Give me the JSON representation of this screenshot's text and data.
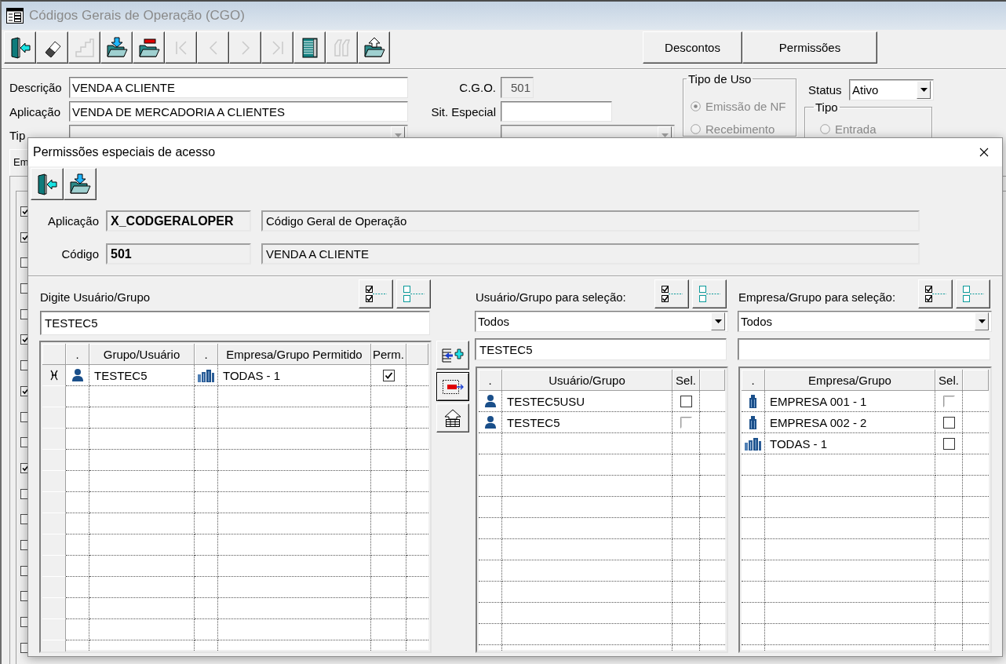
{
  "main_window": {
    "title": "Códigos Gerais de Operação (CGO)",
    "toolbar": [
      {
        "disabled": false
      },
      {
        "disabled": false
      },
      {
        "disabled": true
      },
      {
        "disabled": false
      },
      {
        "disabled": false
      },
      {
        "disabled": true
      },
      {
        "disabled": true
      },
      {
        "disabled": true
      },
      {
        "disabled": true
      },
      {
        "disabled": false
      },
      {
        "disabled": true
      },
      {
        "disabled": false
      }
    ],
    "buttons": [
      "Descontos",
      "Permissões"
    ],
    "fields_left": [
      {
        "kind": "text",
        "label": "Descrição",
        "value": "VENDA A CLIENTE",
        "disabled": false
      },
      {
        "kind": "text",
        "label": "Aplicação",
        "value": "VENDA DE MERCADORIA A CLIENTES",
        "disabled": false
      },
      {
        "kind": "dropdown",
        "label": "Tip",
        "disabled": true
      }
    ],
    "fields_right": [
      {
        "kind": "text",
        "label": "C.G.O.",
        "value": "501",
        "disabled": true
      },
      {
        "kind": "text",
        "label": "Sit. Especial",
        "disabled": false
      },
      {
        "kind": "dropdown",
        "disabled": true
      }
    ],
    "tipo_de_uso": {
      "title": "Tipo de Uso",
      "disabled": true,
      "options": [
        {
          "label": "Emissão de NF",
          "selected": true
        },
        {
          "label": "Recebimento",
          "selected": false
        }
      ]
    },
    "status": {
      "label": "Status",
      "value": "Ativo"
    },
    "tipo": {
      "title": "Tipo",
      "disabled": true,
      "options": [
        {
          "label": "Entrada",
          "selected": false
        }
      ]
    },
    "tab": "Em",
    "checkboxes": [
      {
        "checked": true
      },
      {
        "checked": true
      },
      {
        "checked": false
      },
      {
        "checked": false
      },
      {
        "checked": false
      },
      {
        "checked": true
      },
      {
        "checked": false
      },
      {
        "checked": true
      },
      {
        "checked": false
      },
      {
        "checked": false
      },
      {
        "checked": true
      },
      {
        "checked": false
      },
      {
        "checked": false
      },
      {
        "checked": false
      },
      {
        "checked": false
      },
      {
        "checked": false
      },
      {
        "checked": false
      },
      {
        "checked": false
      }
    ]
  },
  "dialog": {
    "title": "Permissões especiais de acesso",
    "toolbar": [
      {
        "disabled": false
      },
      {
        "disabled": false
      }
    ],
    "info_rows": [
      {
        "label": "Aplicação",
        "code": "X_CODGERALOPER",
        "description": "Código Geral de Operação"
      },
      {
        "label": "Código",
        "code": "501",
        "description": "VENDA A CLIENTE"
      }
    ],
    "permitted": {
      "label": "Digite Usuário/Grupo",
      "input": "TESTEC5",
      "columns": [
        ".",
        "Grupo/Usuário",
        ".",
        "Empresa/Grupo Permitido",
        "Perm."
      ],
      "rows": [
        {
          "current": true,
          "user": "TESTEC5",
          "company": {
            "kind": "group",
            "name": "TODAS - 1"
          },
          "checked": true
        }
      ]
    },
    "transfer_buttons": [
      {
        "focused": false
      },
      {
        "focused": true
      },
      {
        "focused": false
      }
    ],
    "users": {
      "label": "Usuário/Grupo para seleção:",
      "filter": "Todos",
      "search": "TESTEC5",
      "columns": [
        ".",
        "Usuário/Grupo",
        "Sel."
      ],
      "rows": [
        {
          "name": "TESTEC5USU",
          "checked": false,
          "disabled": false
        },
        {
          "name": "TESTEC5",
          "checked": false,
          "disabled": true
        }
      ]
    },
    "companies": {
      "label": "Empresa/Grupo para seleção:",
      "filter": "Todos",
      "columns": [
        ".",
        "Empresa/Grupo",
        "Sel."
      ],
      "rows": [
        {
          "kind": "company",
          "name": "EMPRESA 001 - 1",
          "checked": false,
          "disabled": true
        },
        {
          "kind": "company",
          "name": "EMPRESA 002 - 2",
          "checked": false,
          "disabled": false
        },
        {
          "kind": "group",
          "name": "TODAS - 1",
          "checked": false,
          "disabled": false
        }
      ]
    }
  }
}
